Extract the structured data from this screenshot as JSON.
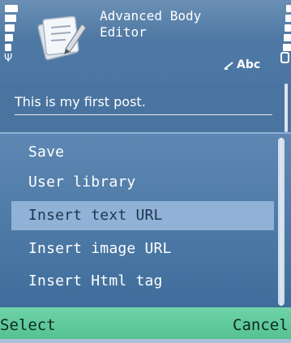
{
  "app": {
    "title_line1": "Advanced Body",
    "title_line2": "Editor",
    "icon": "notepad-pencil-icon",
    "input_mode": "Abc"
  },
  "status": {
    "signal_icon": "signal-strength-icon",
    "battery_icon": "battery-icon",
    "antenna_glyph": "Ψ"
  },
  "editor": {
    "text": "This is my first post."
  },
  "menu": {
    "items": [
      {
        "label": "Save"
      },
      {
        "label": "User library"
      },
      {
        "label": "Insert text URL",
        "selected": true
      },
      {
        "label": "Insert image URL"
      },
      {
        "label": "Insert Html tag"
      }
    ]
  },
  "softkeys": {
    "left": "Select",
    "right": "Cancel"
  },
  "colors": {
    "header": "#4f79a4",
    "menu_bg": "#4b79a8",
    "selection": "#8fb2d6",
    "softkey_bar": "#5fc99b"
  }
}
